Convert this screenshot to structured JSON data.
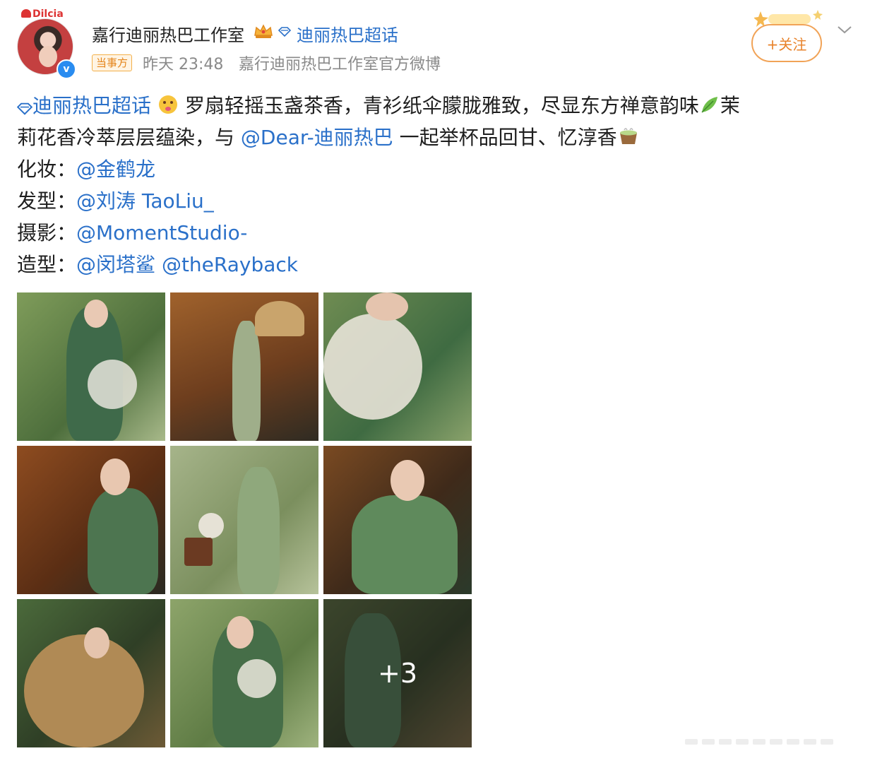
{
  "post": {
    "author_name": "嘉行迪丽热巴工作室",
    "avatar_tag": "Dilcia",
    "supertopic_header": "迪丽热巴超话",
    "source_badge": "当事方",
    "time": "昨天 23:48",
    "source": "嘉行迪丽热巴工作室官方微博",
    "follow_label": "+关注",
    "verified_mark": "v"
  },
  "text": {
    "topic": "迪丽热巴超话",
    "line1_rest": " 罗扇轻摇玉盏茶香，青衫纸伞朦胧雅致，尽显东方禅意韵味",
    "line1_tail": "茉",
    "line2_a": "莉花香冷萃层层蕴染，与 ",
    "mention_dear": "@Dear-迪丽热巴",
    "line2_b": " 一起举杯品回甘、忆淳香",
    "makeup_label": "化妆：",
    "makeup_mention": "@金鹤龙",
    "hair_label": "发型：",
    "hair_mention": "@刘涛 TaoLiu_",
    "photo_label": "摄影：",
    "photo_mention": "@MomentStudio-",
    "styling_label": "造型：",
    "styling_mention_1": "@闵塔鲨",
    "styling_mention_2": "@theRayback"
  },
  "images": {
    "more_count": "+3",
    "count_shown": 9
  },
  "icons": {
    "crown": "crown-badge-icon",
    "diamond": "supertopic-diamond-icon",
    "emoji_1": "face-emoji-icon",
    "emoji_2": "leaf-emoji-icon",
    "emoji_3": "tea-emoji-icon",
    "more": "chevron-down-icon"
  },
  "colors": {
    "link": "#2a70c9",
    "follow": "#e8822a",
    "meta": "#8a8a8a"
  }
}
